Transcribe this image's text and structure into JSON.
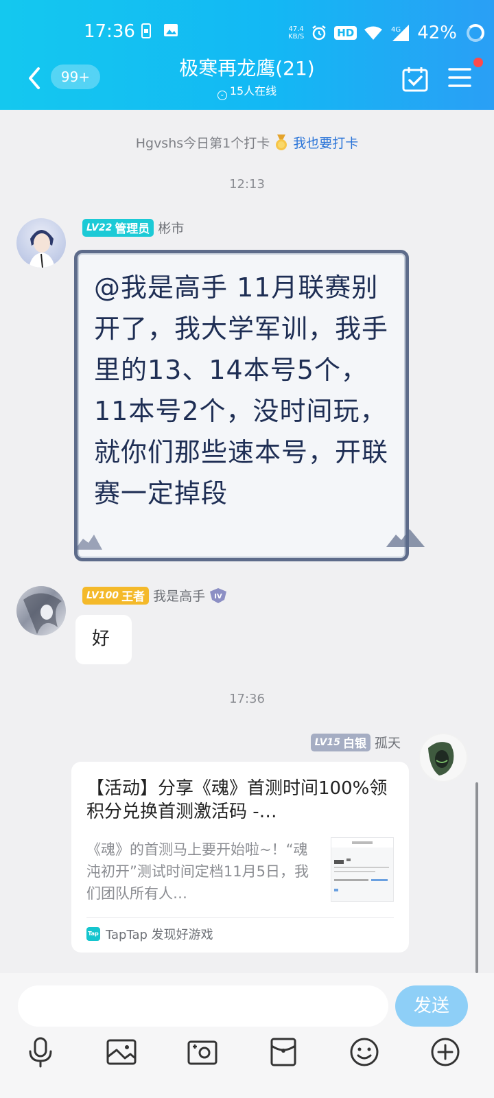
{
  "status_bar": {
    "time": "17:36",
    "net_speed_value": "47.4",
    "net_speed_unit": "KB/S",
    "hd": "HD",
    "net_type": "4G",
    "battery": "42%"
  },
  "header": {
    "unread_badge": "99+",
    "title": "极寒再龙鹰(21)",
    "online_count": "15人在线"
  },
  "system_notice": {
    "text": "Hgvshs今日第1个打卡",
    "link": "我也要打卡"
  },
  "timestamps": [
    "12:13",
    "17:36"
  ],
  "messages": [
    {
      "level": "LV22",
      "role": "管理员",
      "name": "彬市",
      "text": "@我是高手 11月联赛别开了，我大学军训，我手里的13、14本号5个，11本号2个，没时间玩，就你们那些速本号，开联赛一定掉段",
      "badge_color": "#1ccad6"
    },
    {
      "level": "LV100",
      "role": "王者",
      "name": "我是高手",
      "rank_icon": "IV",
      "text": "好",
      "badge_color": "#f4b92a"
    },
    {
      "level": "LV15",
      "role": "白银",
      "name": "孤天",
      "badge_color": "#a5adc3",
      "card": {
        "title": "【活动】分享《魂》首测时间100%领积分兑换首测激活码 -…",
        "desc": "《魂》的首测马上要开始啦~！“魂沌初开”测试时间定档11月5日，我们团队所有人…",
        "source_logo": "Tap",
        "source": "TapTap 发现好游戏"
      }
    }
  ],
  "input": {
    "placeholder": "",
    "send_label": "发送"
  },
  "toolbar_icons": [
    "microphone-icon",
    "image-icon",
    "camera-icon",
    "red-packet-icon",
    "emoji-icon",
    "plus-icon"
  ]
}
